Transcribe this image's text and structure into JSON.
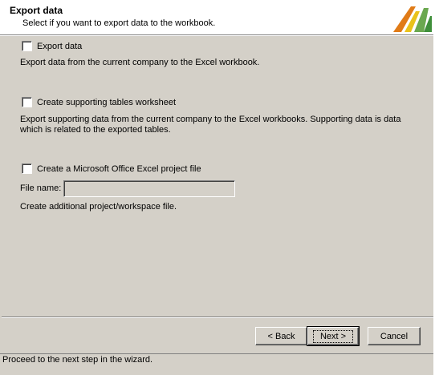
{
  "header": {
    "title": "Export data",
    "subtitle": "Select if you want to export data to the workbook."
  },
  "options": [
    {
      "label": "Export data",
      "checked": false,
      "description": "Export data from the current company to the Excel workbook."
    },
    {
      "label": "Create supporting tables worksheet",
      "checked": false,
      "description_line1": "Export supporting data from the current company to the Excel workbooks. Supporting data is data",
      "description_line2": "which is related to the exported tables."
    },
    {
      "label": "Create a Microsoft Office Excel project file",
      "checked": false,
      "description": "Create additional project/workspace file."
    }
  ],
  "file_name": {
    "label": "File name:",
    "value": ""
  },
  "buttons": {
    "back": "< Back",
    "next": "Next >",
    "cancel": "Cancel"
  },
  "status": "Proceed to the next step in the wizard.",
  "colors": {
    "dialog_bg": "#d4d0c8",
    "header_bg": "#ffffff",
    "logo_green": "#6aa84f",
    "logo_orange": "#e07b17",
    "logo_yellow": "#e9c21b"
  },
  "icons": {
    "logo": "microsoft-dynamics-logo-icon"
  }
}
